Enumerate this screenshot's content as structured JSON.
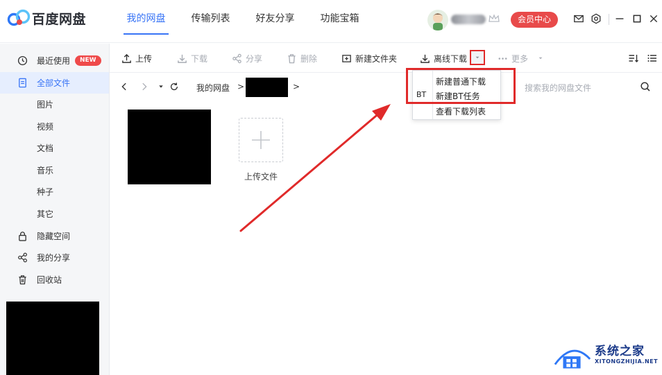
{
  "app": {
    "name": "百度网盘"
  },
  "nav": {
    "tabs": [
      "我的网盘",
      "传输列表",
      "好友分享",
      "功能宝箱"
    ],
    "active_index": 0
  },
  "header": {
    "vip_label": "会员中心"
  },
  "sidebar": {
    "items": [
      {
        "label": "最近使用",
        "icon": "clock-icon",
        "badge": "NEW"
      },
      {
        "label": "全部文件",
        "icon": "file-icon",
        "active": true
      },
      {
        "label": "图片"
      },
      {
        "label": "视频"
      },
      {
        "label": "文档"
      },
      {
        "label": "音乐"
      },
      {
        "label": "种子"
      },
      {
        "label": "其它"
      },
      {
        "label": "隐藏空间",
        "icon": "lock-icon"
      },
      {
        "label": "我的分享",
        "icon": "share-icon"
      },
      {
        "label": "回收站",
        "icon": "trash-icon"
      }
    ]
  },
  "toolbar": {
    "upload": "上传",
    "download": "下载",
    "share": "分享",
    "delete": "删除",
    "new_folder": "新建文件夹",
    "offline_download": "离线下载",
    "more": "更多"
  },
  "pathbar": {
    "root": "我的网盘",
    "sep1": ">",
    "sep2": ">",
    "search_placeholder": "搜索我的网盘文件"
  },
  "files": {
    "upload_tile_label": "上传文件"
  },
  "dropdown_menu": {
    "items": [
      {
        "label": "新建普通下载",
        "prefix": ""
      },
      {
        "label": "新建BT任务",
        "prefix": "BT"
      },
      {
        "label": "查看下载列表",
        "prefix": ""
      }
    ]
  },
  "watermark": {
    "title": "系统之家",
    "subtitle": "XITONGZHIJIA.NET"
  },
  "colors": {
    "accent": "#3874f6",
    "vip": "#e84a4a",
    "annotation": "#e02a2a",
    "sidebar_bg": "#f5f6f8"
  }
}
